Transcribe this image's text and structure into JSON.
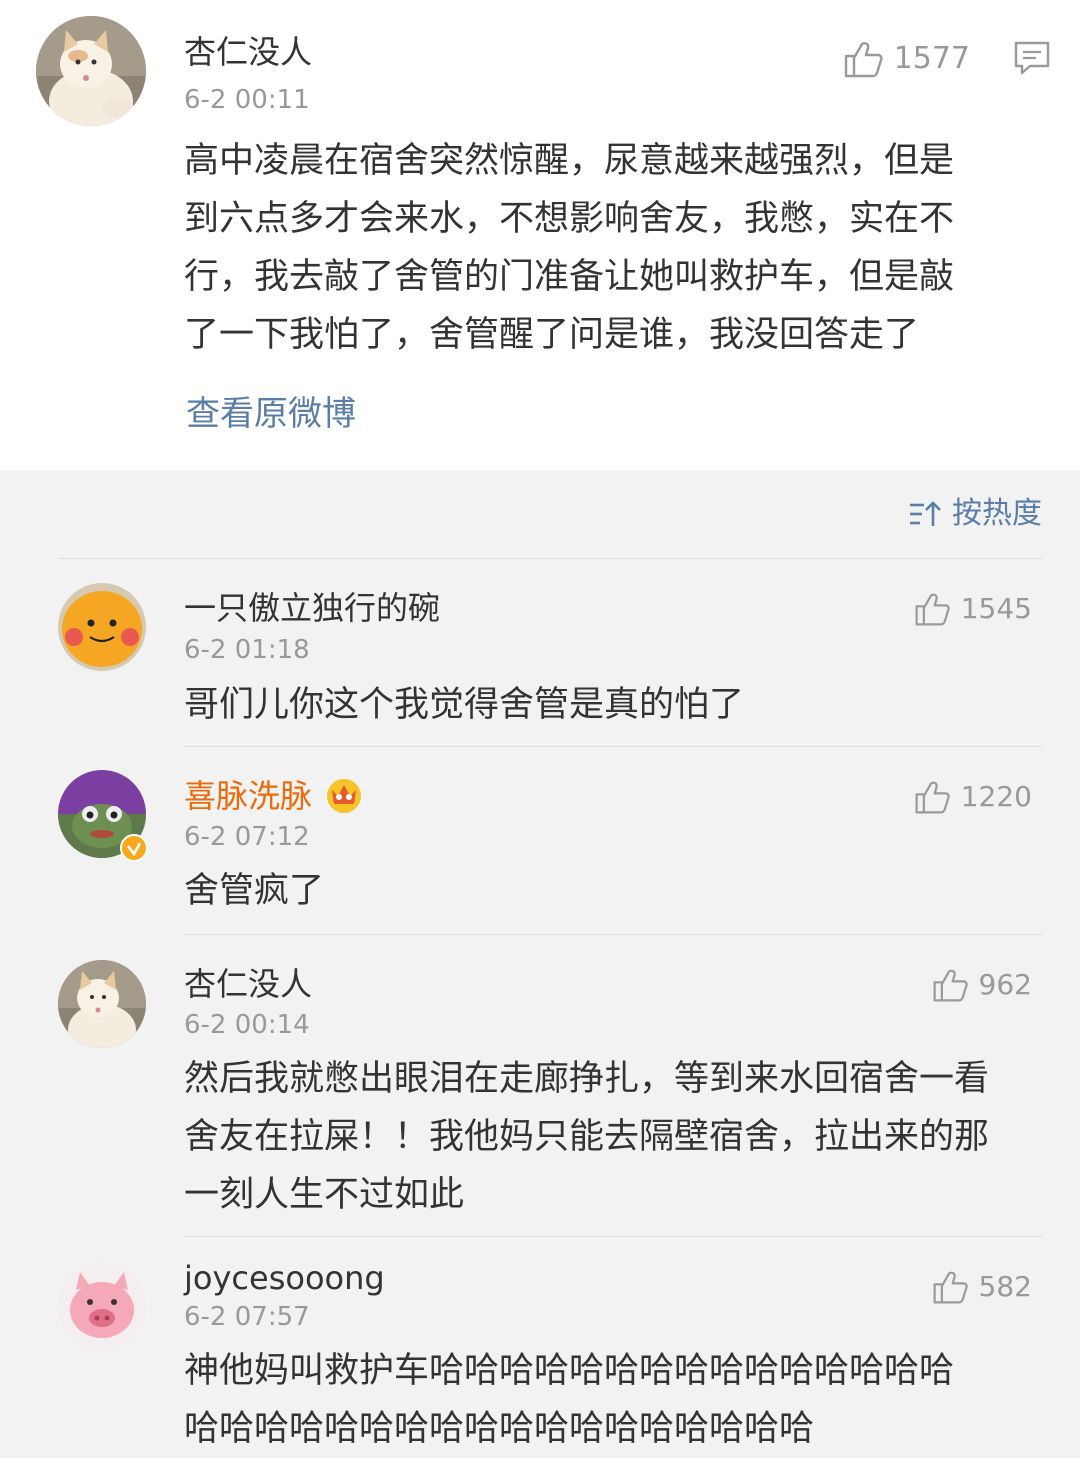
{
  "main_post": {
    "user": "杏仁没人",
    "time": "6-2 00:11",
    "likes": "1577",
    "content_lines": [
      "高中凌晨在宿舍突然惊醒，尿意越来越强烈，但是",
      "到六点多才会来水，不想影响舍友，我憋，实在不",
      "行，我去敲了舍管的门准备让她叫救护车，但是敲",
      "了一下我怕了，舍管醒了问是谁，我没回答走了"
    ],
    "view_original": "查看原微博",
    "icons": {
      "like": "thumbs-up-icon",
      "comment": "comment-icon"
    }
  },
  "sort": {
    "label": "按热度",
    "icon": "sort-icon"
  },
  "comments": [
    {
      "user": "一只傲立独行的碗",
      "time": "6-2 01:18",
      "likes": "1545",
      "lines": [
        "哥们儿你这个我觉得舍管是真的怕了"
      ]
    },
    {
      "user": "喜脉洗脉",
      "time": "6-2 07:12",
      "likes": "1220",
      "lines": [
        "舍管疯了"
      ],
      "badges": [
        "crown-vip-icon",
        "verified-icon"
      ]
    },
    {
      "user": "杏仁没人",
      "time": "6-2 00:14",
      "likes": "962",
      "lines": [
        "然后我就憋出眼泪在走廊挣扎，等到来水回宿舍一看",
        "舍友在拉屎！！我他妈只能去隔壁宿舍，拉出来的那",
        "一刻人生不过如此"
      ]
    },
    {
      "user": "joycesooong",
      "time": "6-2 07:57",
      "likes": "582",
      "lines": [
        "神他妈叫救护车哈哈哈哈哈哈哈哈哈哈哈哈哈哈哈",
        "哈哈哈哈哈哈哈哈哈哈哈哈哈哈哈哈哈哈"
      ]
    }
  ],
  "colors": {
    "link": "#5b7ea8",
    "vip_name": "#e86b0c",
    "muted": "#999999",
    "text": "#333333",
    "page_bg": "#f2f2f2"
  }
}
